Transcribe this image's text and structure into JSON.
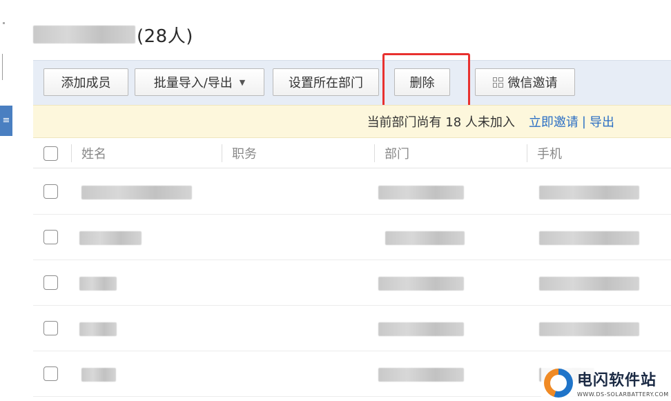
{
  "header": {
    "count_label": "(28人)"
  },
  "toolbar": {
    "add_member": "添加成员",
    "batch_import_export": "批量导入/导出",
    "batch_caret": "▼",
    "set_department": "设置所在部门",
    "delete": "删除",
    "wechat_invite": "微信邀请"
  },
  "notice": {
    "text": "当前部门尚有 18 人未加入",
    "invite_now": "立即邀请",
    "separator": "|",
    "export": "导出"
  },
  "table": {
    "columns": [
      "姓名",
      "职务",
      "部门",
      "手机"
    ],
    "row_count": 5
  },
  "watermark": {
    "name": "电闪软件站",
    "url": "WWW.DS-SOLARBATTERY.COM"
  },
  "colors": {
    "highlight": "#e8312f",
    "link": "#2a6ec4",
    "toolbar_bg": "#e7edf6",
    "notice_bg": "#fdf7dc"
  }
}
